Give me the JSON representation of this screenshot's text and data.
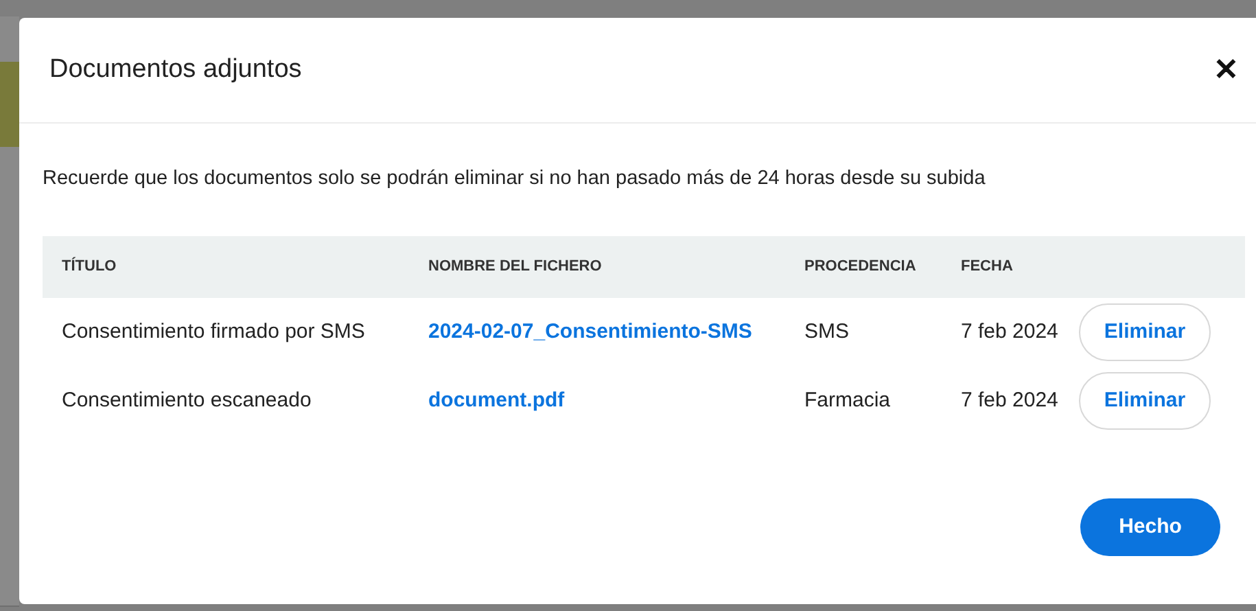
{
  "dialog": {
    "title": "Documentos adjuntos",
    "close": "✕"
  },
  "notice": "Recuerde que los documentos solo se podrán eliminar si no han pasado más de 24 horas desde su subida",
  "table": {
    "columns": [
      "TÍTULO",
      "NOMBRE DEL FICHERO",
      "PROCEDENCIA",
      "FECHA"
    ],
    "rows": [
      {
        "title": "Consentimiento firmado por SMS",
        "file": "2024-02-07_Consentimiento-SMS",
        "source": "SMS",
        "date": "7 feb 2024",
        "action": "Eliminar"
      },
      {
        "title": "Consentimiento escaneado",
        "file": "document.pdf",
        "source": "Farmacia",
        "date": "7 feb 2024",
        "action": "Eliminar"
      }
    ]
  },
  "done_button": "Hecho"
}
